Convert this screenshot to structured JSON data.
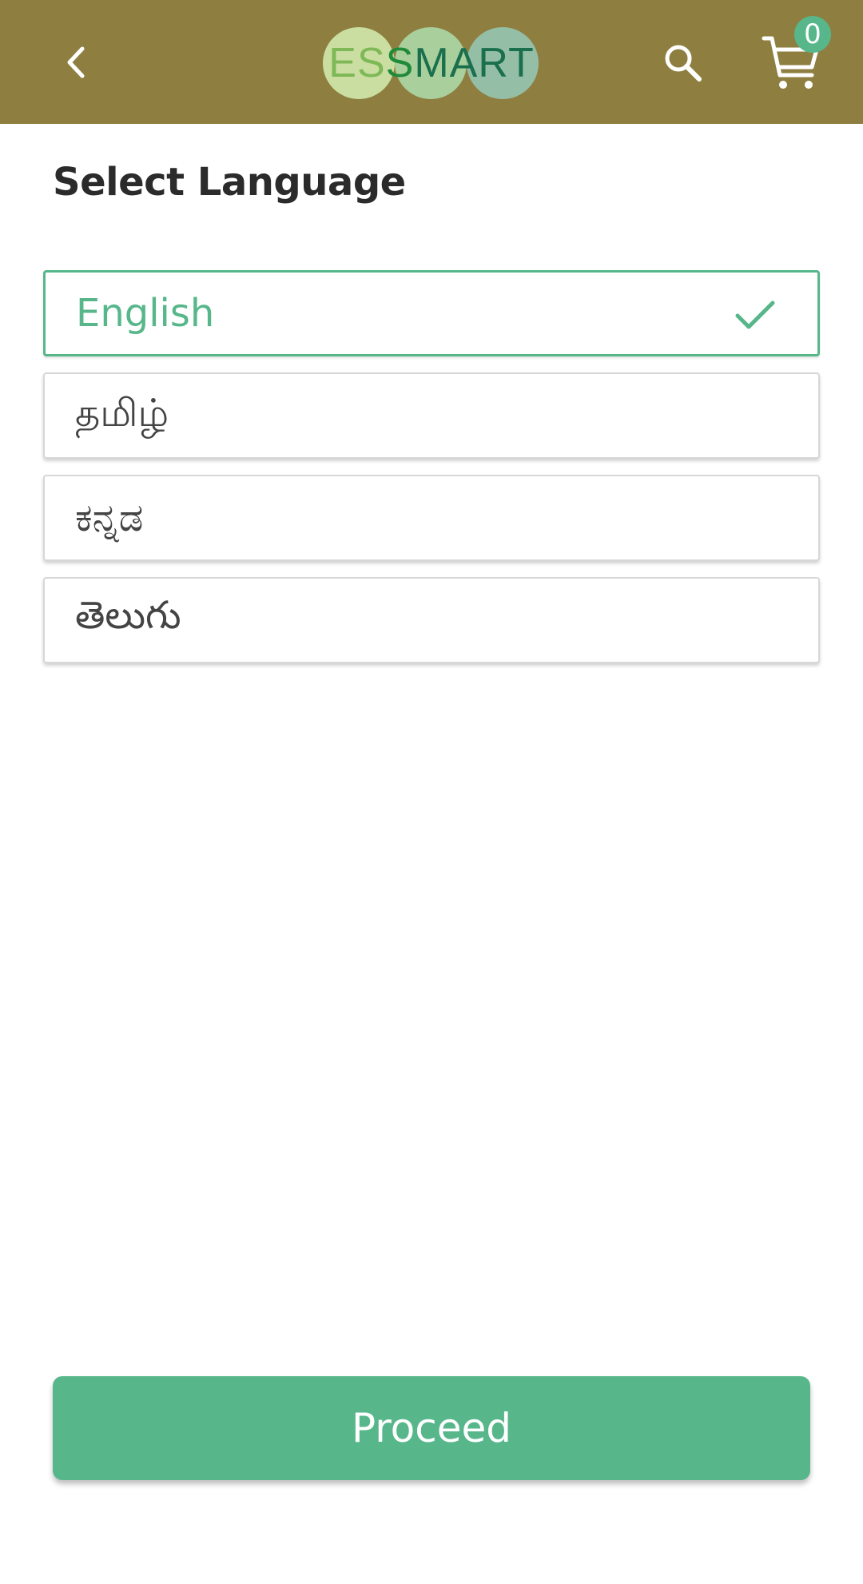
{
  "header": {
    "logo": {
      "part1": "ES",
      "part2": "S",
      "part3": "MART"
    },
    "cart_count": "0",
    "icons": {
      "back": "chevron-left-icon",
      "search": "search-icon",
      "cart": "cart-icon"
    },
    "colors": {
      "background": "#8e7f40",
      "accent": "#57b78b"
    }
  },
  "page": {
    "title": "Select Language"
  },
  "languages": [
    {
      "label": "English",
      "selected": true
    },
    {
      "label": "தமிழ்",
      "selected": false
    },
    {
      "label": "ಕನ್ನಡ",
      "selected": false
    },
    {
      "label": "తెలుగు",
      "selected": false
    }
  ],
  "actions": {
    "proceed_label": "Proceed"
  }
}
